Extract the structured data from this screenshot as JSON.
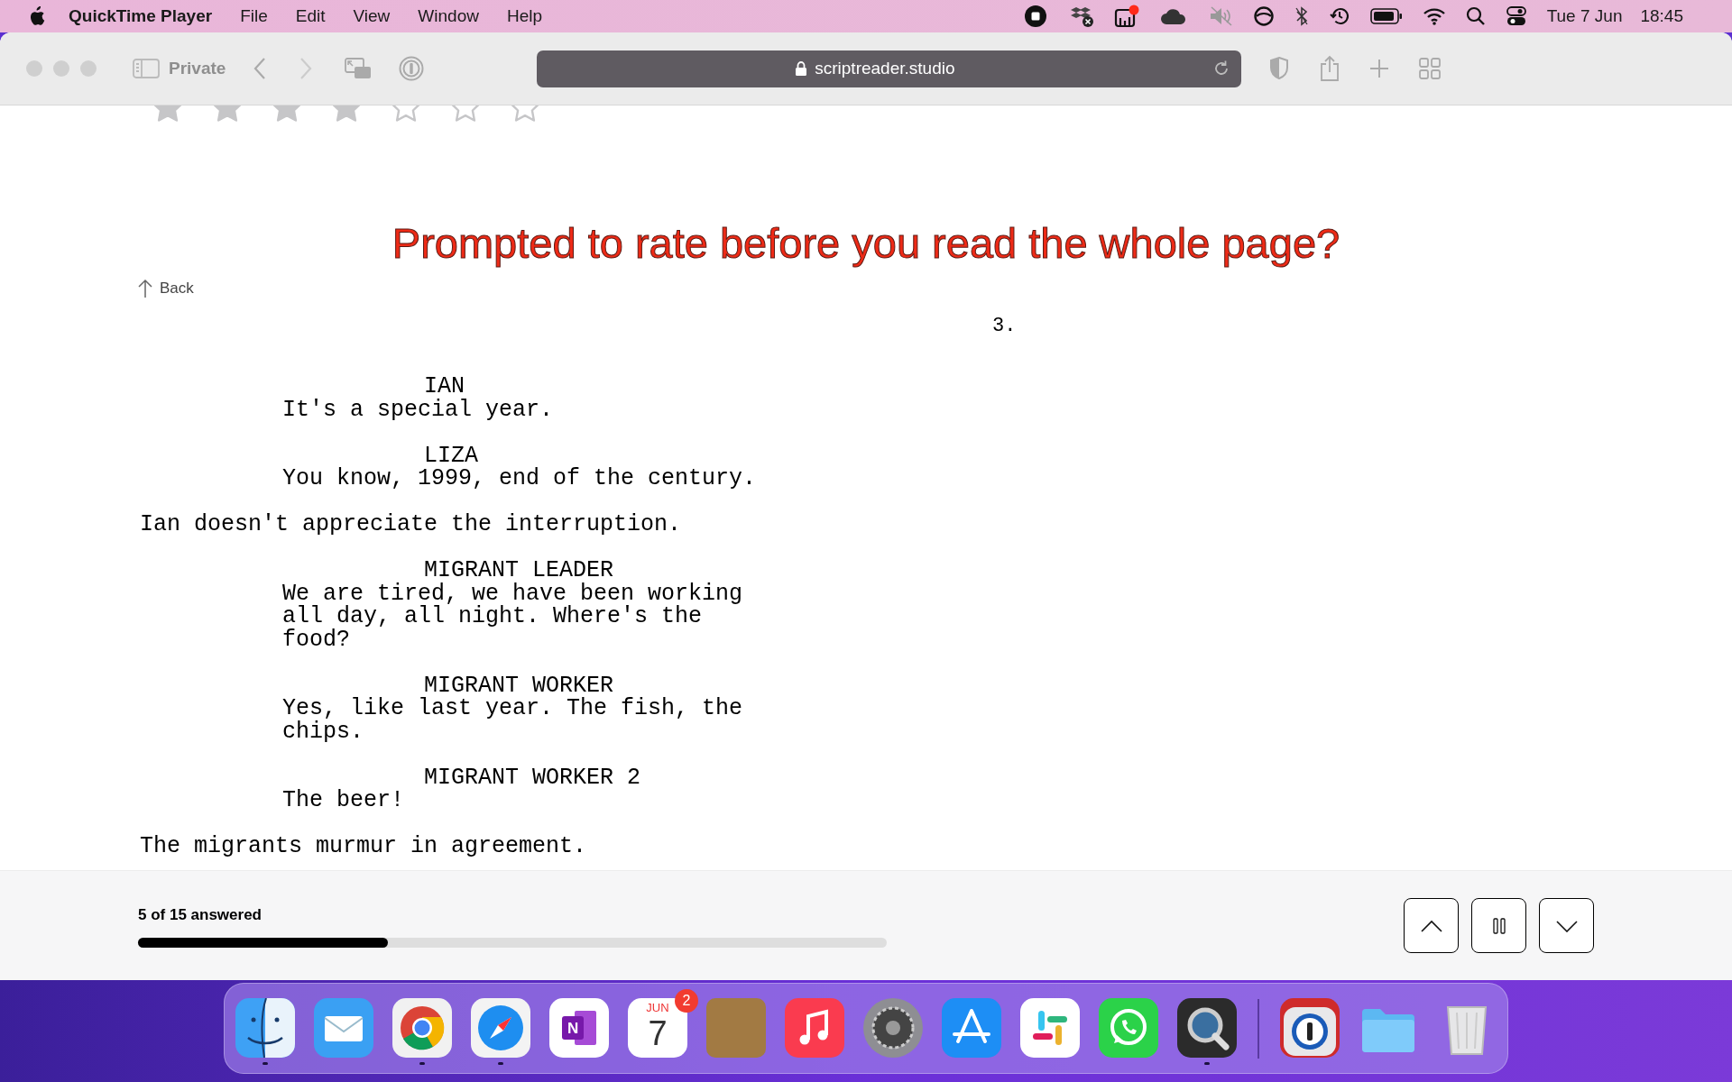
{
  "menu_bar": {
    "app_name": "QuickTime Player",
    "menus": [
      "File",
      "Edit",
      "View",
      "Window",
      "Help"
    ],
    "date": "Tue 7 Jun",
    "time": "18:45"
  },
  "browser": {
    "private_label": "Private",
    "url": "scriptreader.studio"
  },
  "rating": {
    "stars": 4
  },
  "headline": "Prompted to rate before you read the whole page?",
  "back_link": "Back",
  "page_number": "3.",
  "script": [
    {
      "kind": "character",
      "text": "IAN"
    },
    {
      "kind": "dialogue",
      "text": "It's a special year."
    },
    {
      "kind": "character",
      "text": "LIZA"
    },
    {
      "kind": "dialogue",
      "text": "You know, 1999, end of the century."
    },
    {
      "kind": "action",
      "text": "Ian doesn't appreciate the interruption."
    },
    {
      "kind": "character",
      "text": "MIGRANT LEADER"
    },
    {
      "kind": "dialogue",
      "text": "We are tired, we have been working all day, all night. Where's the food?"
    },
    {
      "kind": "character",
      "text": "MIGRANT WORKER"
    },
    {
      "kind": "dialogue",
      "text": "Yes, like last year. The fish, the chips."
    },
    {
      "kind": "character",
      "text": "MIGRANT WORKER 2"
    },
    {
      "kind": "dialogue",
      "text": "The beer!"
    },
    {
      "kind": "action",
      "text": "The migrants murmur in agreement."
    }
  ],
  "progress": {
    "label": "5 of 15 answered",
    "level": 0.334
  },
  "dock": [
    {
      "kind": "finder",
      "running": true
    },
    {
      "kind": "mail",
      "running": false
    },
    {
      "kind": "chrome",
      "running": true
    },
    {
      "kind": "safari",
      "running": true
    },
    {
      "kind": "notes",
      "running": false,
      "letter": "N"
    },
    {
      "kind": "calendar",
      "running": false,
      "month": "JUN",
      "day": "7",
      "badge": "2"
    },
    {
      "kind": "blank",
      "running": false
    },
    {
      "kind": "music",
      "running": false
    },
    {
      "kind": "settings",
      "running": false
    },
    {
      "kind": "appstore",
      "running": false
    },
    {
      "kind": "slack",
      "running": false
    },
    {
      "kind": "whatsapp",
      "running": false
    },
    {
      "kind": "quicktime",
      "running": true
    },
    {
      "kind": "separator"
    },
    {
      "kind": "password",
      "running": false
    },
    {
      "kind": "folder",
      "running": false
    },
    {
      "kind": "trash",
      "running": false
    }
  ]
}
